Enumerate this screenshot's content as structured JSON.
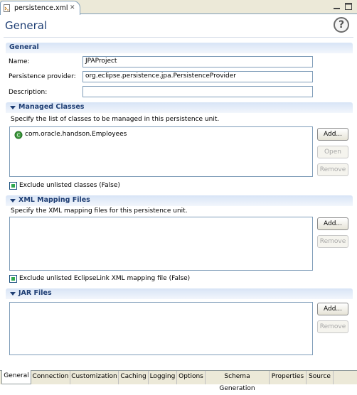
{
  "editor_tab": {
    "label": "persistence.xml",
    "close_glyph": "✕",
    "icon": "xml-file-icon"
  },
  "window_controls": {
    "minimize_icon": "minimize-icon",
    "maximize_icon": "maximize-icon"
  },
  "form": {
    "title": "General",
    "help_icon": "help-icon",
    "help_glyph": "?"
  },
  "general_section": {
    "title": "General",
    "name_label": "Name:",
    "name_value": "JPAProject",
    "provider_label": "Persistence provider:",
    "provider_value": "org.eclipse.persistence.jpa.PersistenceProvider",
    "description_label": "Description:",
    "description_value": ""
  },
  "managed_classes": {
    "title": "Managed Classes",
    "description": "Specify the list of classes to be managed in this persistence unit.",
    "items": [
      {
        "label": "com.oracle.handson.Employees",
        "icon": "java-class-icon"
      }
    ],
    "add_label": "Add...",
    "open_label": "Open",
    "remove_label": "Remove",
    "exclude_label": "Exclude unlisted classes (False)"
  },
  "xml_mapping": {
    "title": "XML Mapping Files",
    "description": "Specify the XML mapping files for this persistence unit.",
    "add_label": "Add...",
    "remove_label": "Remove",
    "exclude_label": "Exclude unlisted EclipseLink XML mapping file (False)"
  },
  "jar_files": {
    "title": "JAR Files",
    "add_label": "Add...",
    "remove_label": "Remove"
  },
  "bottom_tabs": [
    {
      "label": "General",
      "active": true
    },
    {
      "label": "Connection",
      "active": false
    },
    {
      "label": "Customization",
      "active": false
    },
    {
      "label": "Caching",
      "active": false
    },
    {
      "label": "Logging",
      "active": false
    },
    {
      "label": "Options",
      "active": false
    },
    {
      "label": "Schema Generation",
      "active": false
    },
    {
      "label": "Properties",
      "active": false
    },
    {
      "label": "Source",
      "active": false
    }
  ],
  "colors": {
    "section_title": "#1e3e74",
    "border": "#7f9db9",
    "chrome": "#ece9d8"
  }
}
